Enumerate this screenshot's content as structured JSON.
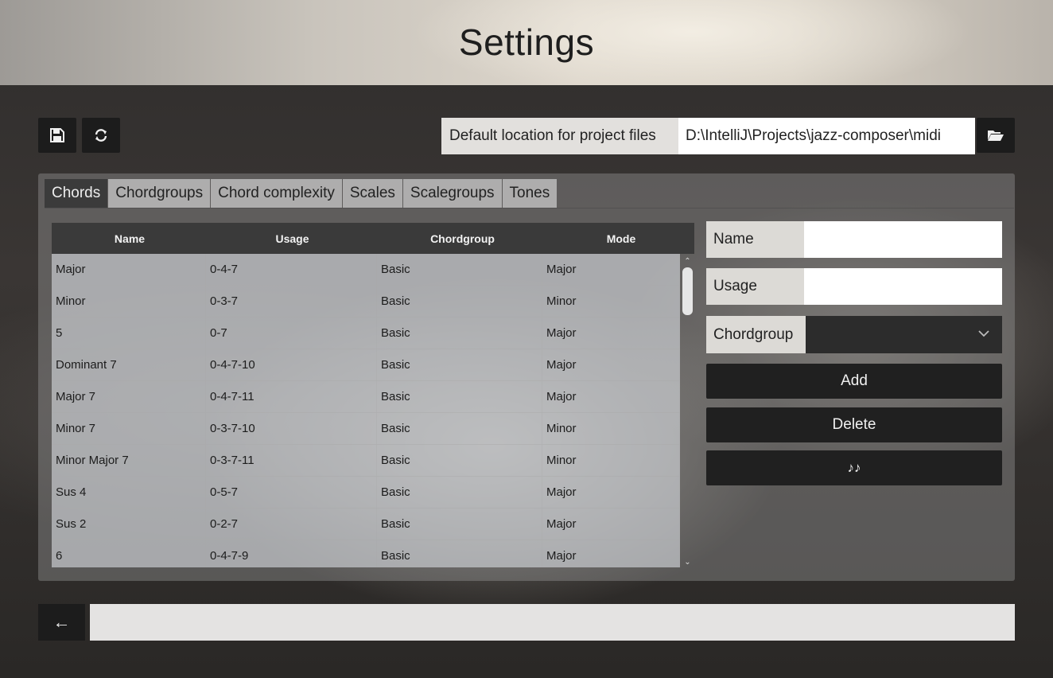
{
  "header": {
    "title": "Settings"
  },
  "toolbar": {
    "save_icon": "floppy-disk-icon",
    "reload_icon": "refresh-icon",
    "location_label": "Default location for project files",
    "location_value": "D:\\IntelliJ\\Projects\\jazz-composer\\midi",
    "browse_icon": "folder-open-icon"
  },
  "tabs": [
    "Chords",
    "Chordgroups",
    "Chord complexity",
    "Scales",
    "Scalegroups",
    "Tones"
  ],
  "active_tab": "Chords",
  "table": {
    "columns": [
      "Name",
      "Usage",
      "Chordgroup",
      "Mode"
    ],
    "rows": [
      [
        "Major",
        "0-4-7",
        "Basic",
        "Major"
      ],
      [
        "Minor",
        "0-3-7",
        "Basic",
        "Minor"
      ],
      [
        "5",
        "0-7",
        "Basic",
        "Major"
      ],
      [
        "Dominant 7",
        "0-4-7-10",
        "Basic",
        "Major"
      ],
      [
        "Major 7",
        "0-4-7-11",
        "Basic",
        "Major"
      ],
      [
        "Minor 7",
        "0-3-7-10",
        "Basic",
        "Minor"
      ],
      [
        "Minor Major 7",
        "0-3-7-11",
        "Basic",
        "Minor"
      ],
      [
        "Sus 4",
        "0-5-7",
        "Basic",
        "Major"
      ],
      [
        "Sus 2",
        "0-2-7",
        "Basic",
        "Major"
      ],
      [
        "6",
        "0-4-7-9",
        "Basic",
        "Major"
      ]
    ]
  },
  "form": {
    "name_label": "Name",
    "name_value": "",
    "usage_label": "Usage",
    "usage_value": "",
    "chordgroup_label": "Chordgroup",
    "chordgroup_value": "",
    "add_label": "Add",
    "delete_label": "Delete",
    "play_icon": "music-notes-icon",
    "play_glyph": "♪♪"
  },
  "footer": {
    "back_glyph": "←",
    "status_text": ""
  }
}
